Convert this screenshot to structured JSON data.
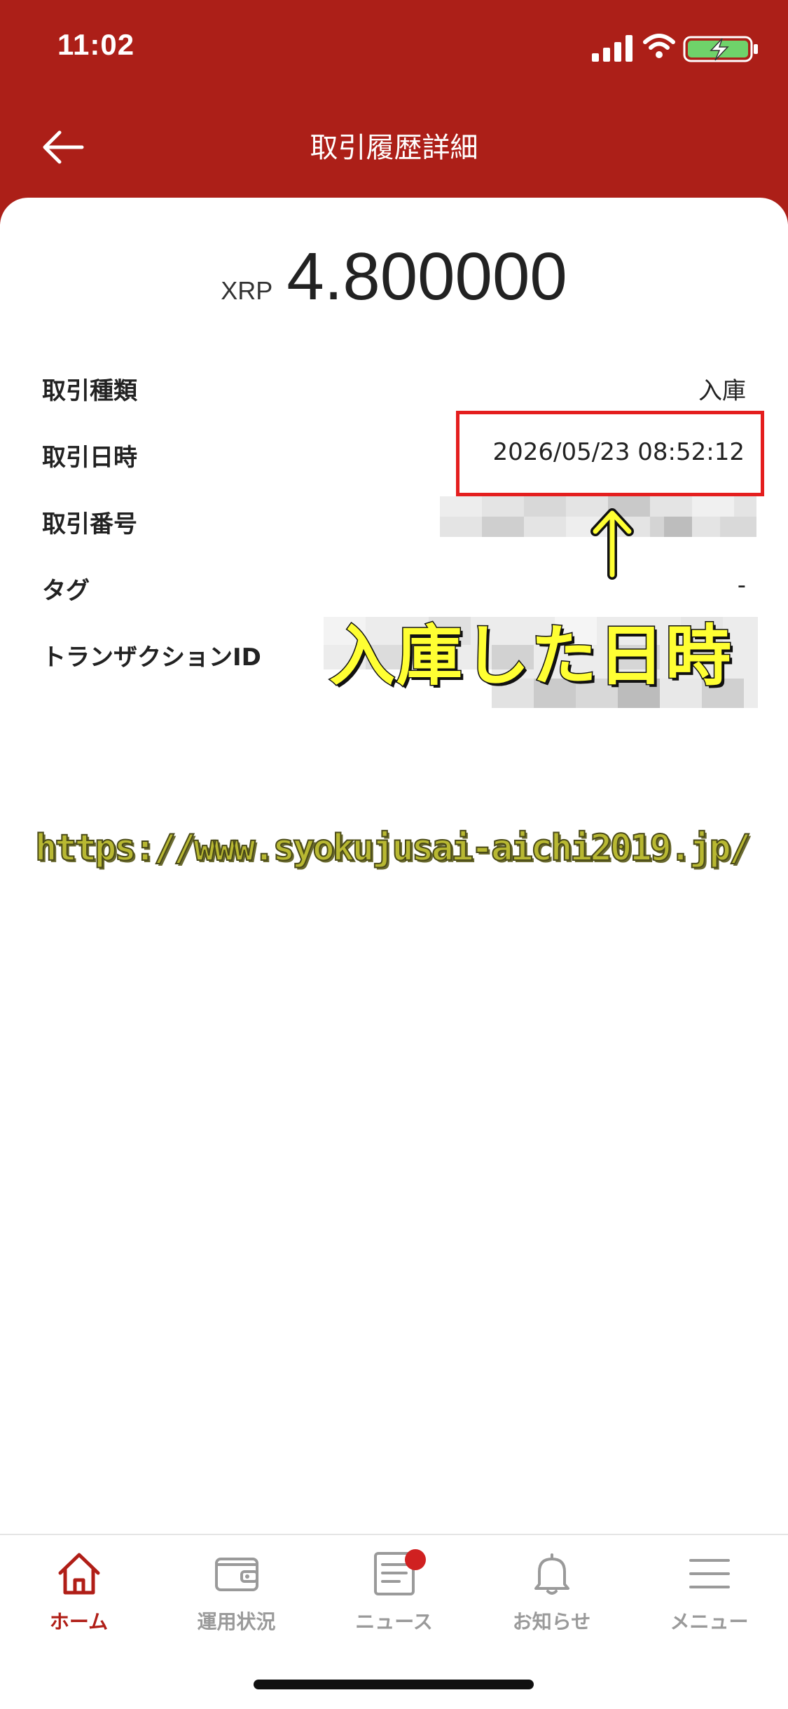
{
  "status_bar": {
    "time": "11:02"
  },
  "header": {
    "title": "取引履歴詳細"
  },
  "amount": {
    "currency": "XRP",
    "value": "4.800000"
  },
  "details": {
    "type_label": "取引種類",
    "type_value": "入庫",
    "datetime_label": "取引日時",
    "datetime_value": "2026/05/23 08:52:12",
    "number_label": "取引番号",
    "tag_label": "タグ",
    "tag_value": "-",
    "txid_label": "トランザクションID"
  },
  "annotation": {
    "text": "入庫した日時"
  },
  "watermark": {
    "url": "https://www.syokujusai-aichi2019.jp/"
  },
  "tab_bar": {
    "tabs": [
      {
        "label": "ホーム",
        "icon": "home-icon",
        "active": true
      },
      {
        "label": "運用状況",
        "icon": "wallet-icon",
        "active": false
      },
      {
        "label": "ニュース",
        "icon": "news-icon",
        "active": false
      },
      {
        "label": "お知らせ",
        "icon": "bell-icon",
        "active": false
      },
      {
        "label": "メニュー",
        "icon": "menu-icon",
        "active": false
      }
    ]
  },
  "colors": {
    "brand": "#ac1f18",
    "active_tab": "#b01e17",
    "highlight": "#e41e1e",
    "annotation": "#ffff33"
  }
}
